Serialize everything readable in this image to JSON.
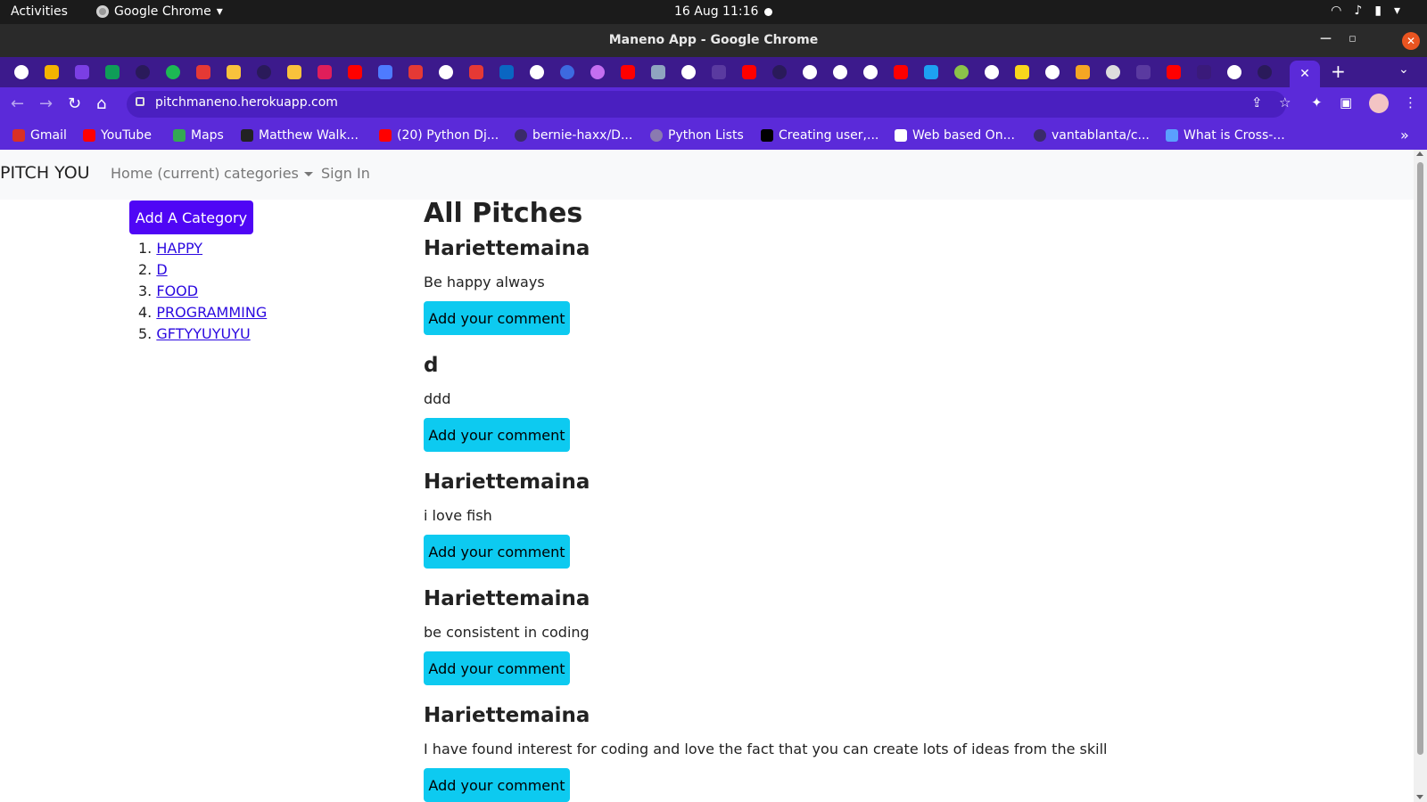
{
  "os_topbar": {
    "activities": "Activities",
    "app_name": "Google Chrome",
    "clock": "16 Aug  11:16"
  },
  "window": {
    "title": "Maneno App - Google Chrome"
  },
  "browser": {
    "url": "pitchmaneno.herokuapp.com",
    "bookmarks": [
      {
        "label": "Gmail",
        "icon": "gmail-icon",
        "color": "#d93025"
      },
      {
        "label": "YouTube",
        "icon": "youtube-icon",
        "color": "#ff0000"
      },
      {
        "label": "Maps",
        "icon": "maps-icon",
        "color": "#34a853"
      },
      {
        "label": "Matthew Walk...",
        "icon": "bookmark-icon",
        "color": "#222222"
      },
      {
        "label": "(20) Python Dj...",
        "icon": "youtube-icon",
        "color": "#ff0000"
      },
      {
        "label": "bernie-haxx/D...",
        "icon": "github-icon",
        "color": "#3a2a6a"
      },
      {
        "label": "Python Lists",
        "icon": "globe-icon",
        "color": "#8a7ab0"
      },
      {
        "label": "Creating user,...",
        "icon": "medium-icon",
        "color": "#000000"
      },
      {
        "label": "Web based On...",
        "icon": "bookmark-icon",
        "color": "#ffffff"
      },
      {
        "label": "vantablanta/c...",
        "icon": "github-icon",
        "color": "#3a2a6a"
      },
      {
        "label": "What is Cross-...",
        "icon": "bookmark-icon",
        "color": "#5aa0ff"
      }
    ],
    "accent": "#5b2ad9"
  },
  "navbar": {
    "brand": "PITCH YOU",
    "home": "Home (current)",
    "categories": "categories",
    "signin": "Sign In"
  },
  "sidebar": {
    "add_button": "Add A Category",
    "categories": [
      {
        "num": "1.",
        "label": "HAPPY"
      },
      {
        "num": "2.",
        "label": "D"
      },
      {
        "num": "3.",
        "label": "FOOD"
      },
      {
        "num": "4.",
        "label": "PROGRAMMING"
      },
      {
        "num": "5.",
        "label": "GFTYYUYUYU"
      }
    ]
  },
  "main": {
    "heading": "All Pitches",
    "comment_button": "Add your comment",
    "pitches": [
      {
        "author": "Hariettemaina",
        "text": "Be happy always"
      },
      {
        "author": "d",
        "text": "ddd"
      },
      {
        "author": "Hariettemaina",
        "text": "i love fish"
      },
      {
        "author": "Hariettemaina",
        "text": "be consistent in coding"
      },
      {
        "author": "Hariettemaina",
        "text": "I have found interest for coding and love the fact that you can create lots of ideas from the skill"
      }
    ]
  }
}
